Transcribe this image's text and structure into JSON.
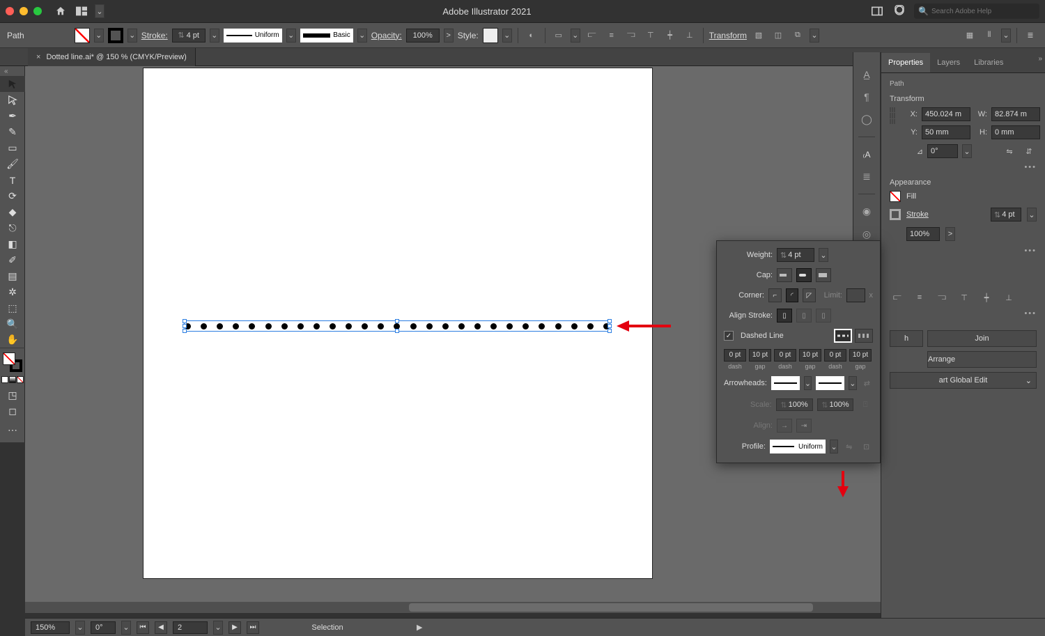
{
  "titlebar": {
    "app_title": "Adobe Illustrator 2021",
    "search_placeholder": "Search Adobe Help"
  },
  "controlbar": {
    "selection_label": "Path",
    "stroke_label": "Stroke:",
    "stroke_weight": "4 pt",
    "profile_label": "Uniform",
    "brush_label": "Basic",
    "opacity_label": "Opacity:",
    "opacity_value": "100%",
    "style_label": "Style:",
    "transform_label": "Transform"
  },
  "document": {
    "tab_title": "Dotted line.ai* @ 150 % (CMYK/Preview)"
  },
  "status": {
    "zoom": "150%",
    "rotation": "0°",
    "artboard": "2",
    "mode": "Selection"
  },
  "panels": {
    "tabs": {
      "properties": "Properties",
      "layers": "Layers",
      "libraries": "Libraries"
    },
    "object_type": "Path",
    "transform": {
      "title": "Transform",
      "x_label": "X:",
      "x_value": "450.024 m",
      "y_label": "Y:",
      "y_value": "50 mm",
      "w_label": "W:",
      "w_value": "82.874 m",
      "h_label": "H:",
      "h_value": "0 mm",
      "angle_value": "0°"
    },
    "appearance": {
      "title": "Appearance",
      "fill_label": "Fill",
      "stroke_label": "Stroke",
      "stroke_weight": "4 pt",
      "opacity_value": "100%"
    },
    "actions": {
      "join": "Join",
      "arrange": "Arrange",
      "global_edit": "art Global Edit"
    }
  },
  "stroke_popup": {
    "weight_label": "Weight:",
    "weight_value": "4 pt",
    "cap_label": "Cap:",
    "corner_label": "Corner:",
    "limit_label": "Limit:",
    "limit_suffix": "x",
    "align_stroke_label": "Align Stroke:",
    "dashed_label": "Dashed Line",
    "dash_fields": [
      "0 pt",
      "10 pt",
      "0 pt",
      "10 pt",
      "0 pt",
      "10 pt"
    ],
    "dash_sub_labels": [
      "dash",
      "gap",
      "dash",
      "gap",
      "dash",
      "gap"
    ],
    "arrowheads_label": "Arrowheads:",
    "scale_label": "Scale:",
    "scale_value_a": "100%",
    "scale_value_b": "100%",
    "align_label": "Align:",
    "profile_label": "Profile:",
    "profile_value": "Uniform"
  }
}
